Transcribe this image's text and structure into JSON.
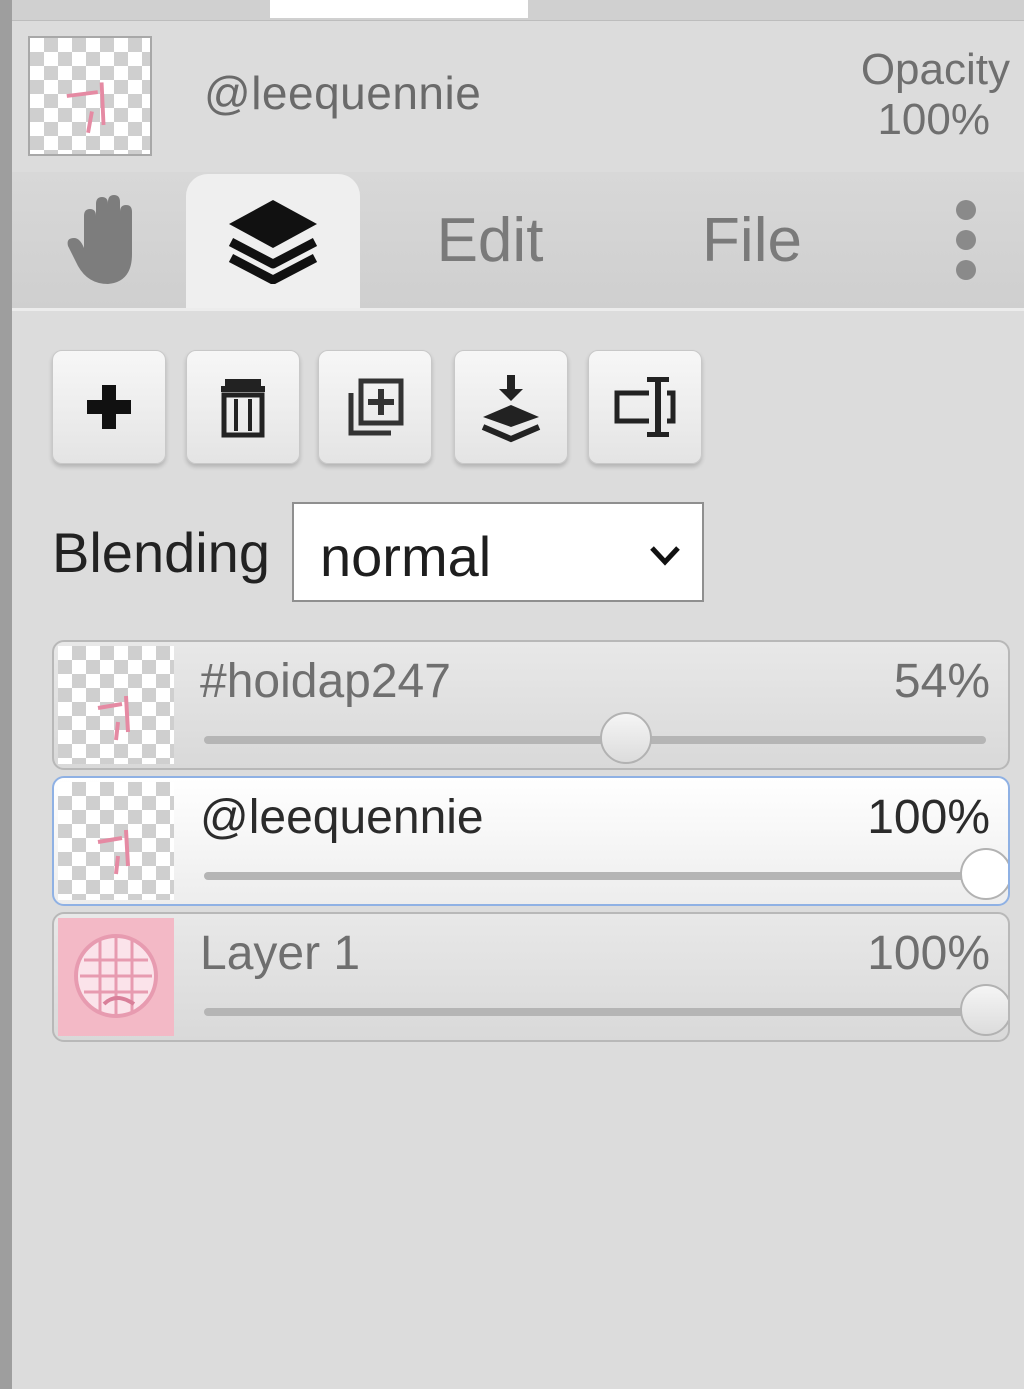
{
  "header": {
    "layer_name": "@leequennie",
    "opacity_label": "Opacity",
    "opacity_value": "100%"
  },
  "tabs": [
    {
      "id": "hand",
      "icon": "hand-icon"
    },
    {
      "id": "layers",
      "icon": "layers-icon",
      "active": true
    },
    {
      "id": "edit",
      "label": "Edit"
    },
    {
      "id": "file",
      "label": "File"
    },
    {
      "id": "more",
      "icon": "more-vertical-icon"
    }
  ],
  "toolbar": [
    {
      "id": "add",
      "icon": "plus-icon"
    },
    {
      "id": "delete",
      "icon": "trash-icon"
    },
    {
      "id": "duplicate",
      "icon": "duplicate-icon"
    },
    {
      "id": "merge-down",
      "icon": "merge-down-icon"
    },
    {
      "id": "rename",
      "icon": "rename-icon"
    }
  ],
  "blending": {
    "label": "Blending",
    "value": "normal"
  },
  "layers": [
    {
      "name": "#hoidap247",
      "opacity_label": "54%",
      "opacity": 54,
      "active": false,
      "thumb": "transparent"
    },
    {
      "name": "@leequennie",
      "opacity_label": "100%",
      "opacity": 100,
      "active": true,
      "thumb": "transparent"
    },
    {
      "name": "Layer 1",
      "opacity_label": "100%",
      "opacity": 100,
      "active": false,
      "thumb": "pink-image"
    }
  ],
  "colors": {
    "panel_bg": "#dcdcdc",
    "active_layer_border": "#8fb1e4",
    "thumb_pink": "#f3b9c6"
  }
}
